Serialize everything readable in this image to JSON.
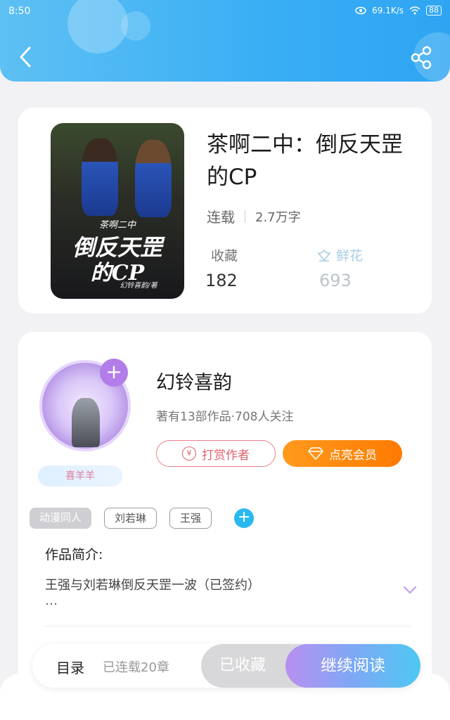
{
  "status_bar": {
    "time": "8:50",
    "speed": "69.1K/s",
    "battery": "88"
  },
  "header": {
    "back_icon": "chevron-left-icon",
    "share_icon": "share-icon"
  },
  "book": {
    "title": "茶啊二中：倒反天罡的CP",
    "status": "连载",
    "word_count": "2.7万字",
    "favorites_label": "收藏",
    "favorites_value": "182",
    "flowers_label": "鲜花",
    "flowers_value": "693",
    "cover": {
      "subtitle": "茶啊二中",
      "line1": "倒反天罡",
      "line2": "的CP",
      "author": "幻铃喜韵/著"
    }
  },
  "author": {
    "name": "幻铃喜韵",
    "stats": "著有13部作品·708人关注",
    "badge": "喜羊羊",
    "tip_label": "打赏作者",
    "vip_label": "点亮会员"
  },
  "tags": [
    "动漫同人",
    "刘若琳",
    "王强"
  ],
  "intro": {
    "title": "作品简介:",
    "text": "王强与刘若琳倒反天罡一波（已签约）",
    "more": "…"
  },
  "bottom_bar": {
    "toc_label": "目录",
    "toc_count": "已连载20章",
    "collected_label": "已收藏",
    "read_label": "继续阅读"
  },
  "colors": {
    "header": "#39aef5",
    "accent_orange": "#ff8a10",
    "tip_red": "#e0626c",
    "purple": "#b27de8"
  }
}
